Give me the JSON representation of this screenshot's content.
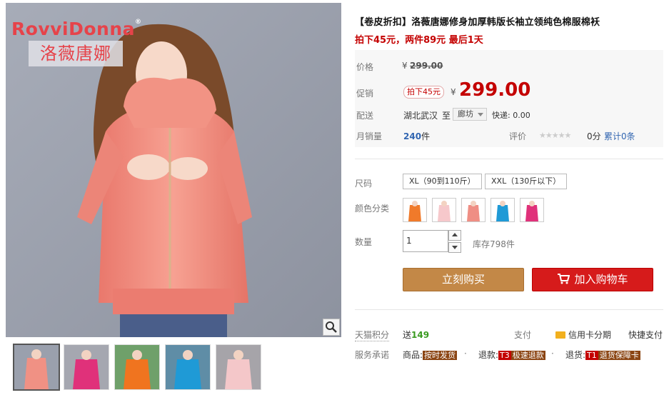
{
  "gallery": {
    "brand": "RovviDonna",
    "brand_reg": "®",
    "brand_cn": "洛薇唐娜",
    "zoom_icon": "magnifier-icon"
  },
  "product": {
    "title": "【卷皮折扣】洛薇唐娜修身加厚韩版长袖立领纯色棉服棉袄",
    "subtitle": "拍下45元，两件89元 最后1天"
  },
  "pricing": {
    "price_label": "价格",
    "currency": "¥",
    "original_price": "299.00",
    "promo_label": "促销",
    "promo_tag": "拍下45元",
    "promo_price": "299.00",
    "shipping_label": "配送",
    "origin": "湖北武汉",
    "to": "至",
    "destination": "廊坊",
    "express": "快递: 0.00",
    "sales_label": "月销量",
    "sales_count": "240",
    "sales_unit": "件",
    "rating_label": "评价",
    "stars": "★★★★★",
    "rating_score": "0分",
    "review_count": "累计0条"
  },
  "options": {
    "size_label": "尺码",
    "sizes": [
      "XL（90到110斤）",
      "XXL（130斤以下）"
    ],
    "color_label": "颜色分类",
    "qty_label": "数量",
    "qty_value": "1",
    "stock": "库存798件"
  },
  "actions": {
    "buy_now": "立刻购买",
    "add_cart": "加入购物车",
    "cart_icon": "cart-icon"
  },
  "services": {
    "points_label": "天猫积分",
    "points_prefix": "送",
    "points_value": "149",
    "pay_label": "支付",
    "credit": "信用卡分期",
    "express_pay": "快捷支付",
    "promise_label": "服务承诺",
    "goods_label": "商品:",
    "goods_badge": "按时发货",
    "refund_label": "退款:",
    "refund_mark": "T3",
    "refund_badge": "极速退款",
    "return_label": "退货:",
    "return_mark": "T1",
    "return_badge": "退货保障卡",
    "dot": "·"
  },
  "colors": {
    "accent_red": "#c40000",
    "buy_orange": "#c38847",
    "cart_red": "#d61b1b",
    "jacket_pink": "#f08b7e"
  }
}
